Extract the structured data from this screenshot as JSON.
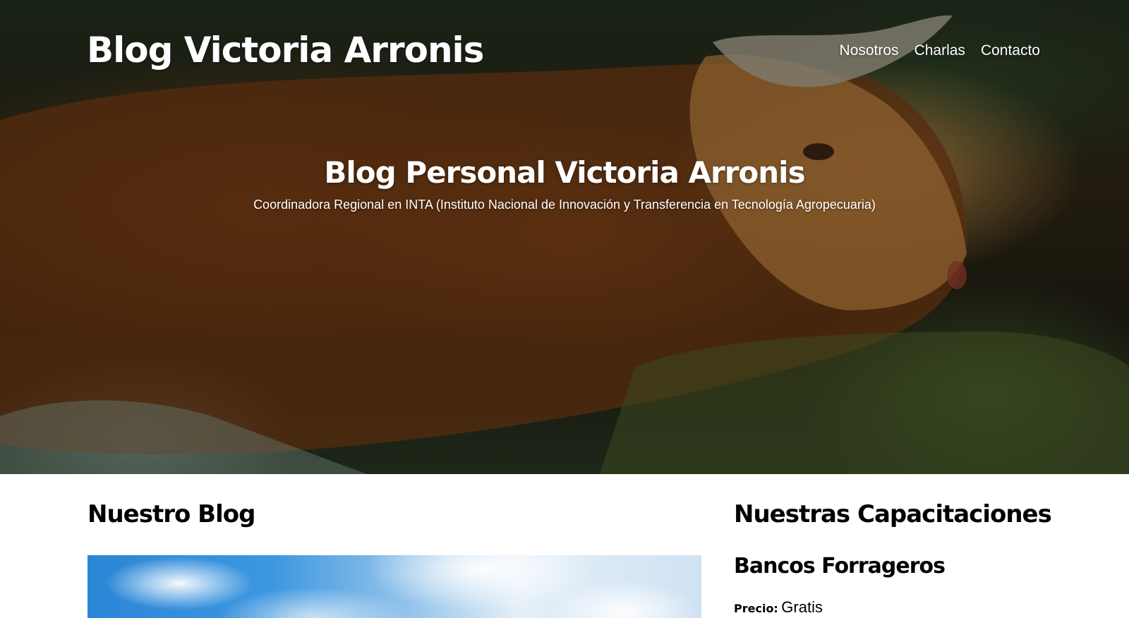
{
  "header": {
    "site_title": "Blog Victoria Arronis",
    "nav": [
      {
        "label": "Nosotros"
      },
      {
        "label": "Charlas"
      },
      {
        "label": "Contacto"
      }
    ]
  },
  "hero": {
    "heading": "Blog Personal Victoria Arronis",
    "subtitle": "Coordinadora Regional en INTA (Instituto Nacional de Innovación y Transferencia en Tecnología Agropecuaria)"
  },
  "blog": {
    "heading": "Nuestro Blog"
  },
  "trainings": {
    "heading": "Nuestras Capacitaciones",
    "courses": [
      {
        "title": "Bancos Forrageros",
        "price_label": "Precio:",
        "price_value": "Gratis"
      }
    ]
  },
  "colors": {
    "text_light": "#ffffff",
    "text_dark": "#000000",
    "background": "#ffffff"
  }
}
